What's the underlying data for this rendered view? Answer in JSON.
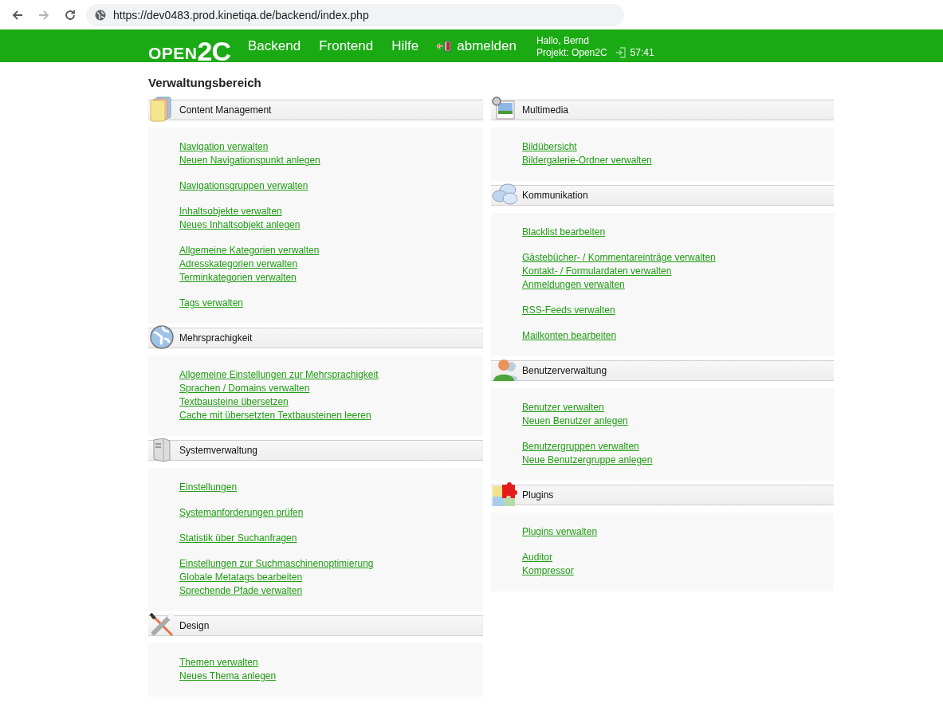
{
  "browser": {
    "back": {
      "disabled": false
    },
    "forward": {
      "disabled": true
    },
    "url": "https://dev0483.prod.kinetiqa.de/backend/index.php"
  },
  "header": {
    "logo": [
      "OPEN",
      "2C"
    ],
    "nav": [
      {
        "label": "Backend",
        "kind": "link"
      },
      {
        "label": "Frontend",
        "kind": "link"
      },
      {
        "label": "Hilfe",
        "kind": "link"
      },
      {
        "label": "abmelden",
        "kind": "logout"
      }
    ],
    "greeting": "Hallo, Bernd",
    "project": "Projekt: Open2C",
    "session_time": "57:41"
  },
  "page_title": "Verwaltungsbereich",
  "columns": [
    [
      {
        "title": "Content Management",
        "groups": [
          [
            "Navigation verwalten",
            "Neuen Navigationspunkt anlegen"
          ],
          [
            "Navigationsgruppen verwalten"
          ],
          [
            "Inhaltsobjekte verwalten",
            "Neues Inhaltsobjekt anlegen"
          ],
          [
            "Allgemeine Kategorien verwalten",
            "Adresskategorien verwalten",
            "Terminkategorien verwalten"
          ],
          [
            "Tags verwalten"
          ]
        ]
      },
      {
        "title": "Mehrsprachigkeit",
        "groups": [
          [
            "Allgemeine Einstellungen zur Mehrsprachigkeit",
            "Sprachen / Domains verwalten",
            "Textbausteine übersetzen",
            "Cache mit übersetzten Textbausteinen leeren"
          ]
        ]
      },
      {
        "title": "Systemverwaltung",
        "groups": [
          [
            "Einstellungen"
          ],
          [
            "Systemanforderungen prüfen"
          ],
          [
            "Statistik über Suchanfragen"
          ],
          [
            "Einstellungen zur Suchmaschinenoptimierung",
            "Globale Metatags bearbeiten",
            "Sprechende Pfade verwalten"
          ]
        ]
      },
      {
        "title": "Design",
        "groups": [
          [
            "Themen verwalten",
            "Neues Thema anlegen"
          ]
        ]
      }
    ],
    [
      {
        "title": "Multimedia",
        "groups": [
          [
            "Bildübersicht",
            "Bildergalerie-Ordner verwalten"
          ]
        ]
      },
      {
        "title": "Kommunikation",
        "groups": [
          [
            "Blacklist bearbeiten"
          ],
          [
            "Gästebücher- / Kommentareinträge verwalten",
            "Kontakt- / Formulardaten verwalten",
            "Anmeldungen verwalten"
          ],
          [
            "RSS-Feeds verwalten"
          ],
          [
            "Mailkonten bearbeiten"
          ]
        ]
      },
      {
        "title": "Benutzerverwaltung",
        "groups": [
          [
            "Benutzer verwalten",
            "Neuen Benutzer anlegen"
          ],
          [
            "Benutzergruppen verwalten",
            "Neue Benutzergruppe anlegen"
          ]
        ]
      },
      {
        "title": "Plugins",
        "groups": [
          [
            "Plugins verwalten"
          ],
          [
            "Auditor",
            "Kompressor"
          ]
        ]
      }
    ]
  ]
}
